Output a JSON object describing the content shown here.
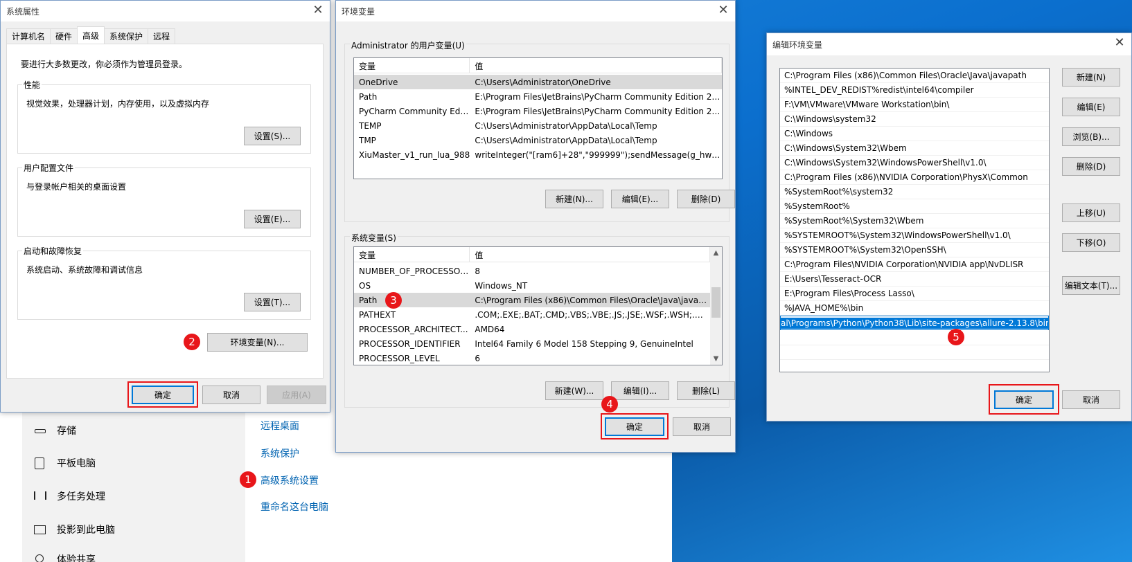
{
  "settings_window": {
    "left_items": [
      {
        "label": "存储",
        "icon": "storage-icon"
      },
      {
        "label": "平板电脑",
        "icon": "tablet-icon"
      },
      {
        "label": "多任务处理",
        "icon": "multitask-icon"
      },
      {
        "label": "投影到此电脑",
        "icon": "project-icon"
      },
      {
        "label": "体验共享",
        "icon": "share-icon"
      }
    ],
    "links": [
      "远程桌面",
      "系统保护",
      "高级系统设置",
      "重命名这台电脑"
    ]
  },
  "system_properties": {
    "title": "系统属性",
    "tabs": [
      "计算机名",
      "硬件",
      "高级",
      "系统保护",
      "远程"
    ],
    "admin_note": "要进行大多数更改，你必须作为管理员登录。",
    "performance": {
      "label": "性能",
      "desc": "视觉效果，处理器计划，内存使用，以及虚拟内存",
      "button": "设置(S)..."
    },
    "user_profile": {
      "label": "用户配置文件",
      "desc": "与登录帐户相关的桌面设置",
      "button": "设置(E)..."
    },
    "startup": {
      "label": "启动和故障恢复",
      "desc": "系统启动、系统故障和调试信息",
      "button": "设置(T)..."
    },
    "env_button": "环境变量(N)...",
    "ok": "确定",
    "cancel": "取消",
    "apply": "应用(A)"
  },
  "env_vars": {
    "title": "环境变量",
    "user_section": "Administrator 的用户变量(U)",
    "col_var": "变量",
    "col_val": "值",
    "user_vars": [
      {
        "name": "OneDrive",
        "value": "C:\\Users\\Administrator\\OneDrive"
      },
      {
        "name": "Path",
        "value": "E:\\Program Files\\JetBrains\\PyCharm Community Edition 2024...."
      },
      {
        "name": "PyCharm Community Editi...",
        "value": "E:\\Program Files\\JetBrains\\PyCharm Community Edition 2024...."
      },
      {
        "name": "TEMP",
        "value": "C:\\Users\\Administrator\\AppData\\Local\\Temp"
      },
      {
        "name": "TMP",
        "value": "C:\\Users\\Administrator\\AppData\\Local\\Temp"
      },
      {
        "name": "XiuMaster_v1_run_lua_988",
        "value": "writeInteger(\"[ram6]+28\",\"999999\");sendMessage(g_hwnd_ui,..."
      }
    ],
    "user_new": "新建(N)...",
    "user_edit": "编辑(E)...",
    "user_delete": "删除(D)",
    "system_section": "系统变量(S)",
    "system_vars": [
      {
        "name": "NUMBER_OF_PROCESSORS",
        "value": "8"
      },
      {
        "name": "OS",
        "value": "Windows_NT"
      },
      {
        "name": "Path",
        "value": "C:\\Program Files (x86)\\Common Files\\Oracle\\Java\\javapath;%..."
      },
      {
        "name": "PATHEXT",
        "value": ".COM;.EXE;.BAT;.CMD;.VBS;.VBE;.JS;.JSE;.WSF;.WSH;.MSC"
      },
      {
        "name": "PROCESSOR_ARCHITECT...",
        "value": "AMD64"
      },
      {
        "name": "PROCESSOR_IDENTIFIER",
        "value": "Intel64 Family 6 Model 158 Stepping 9, GenuineIntel"
      },
      {
        "name": "PROCESSOR_LEVEL",
        "value": "6"
      }
    ],
    "sys_new": "新建(W)...",
    "sys_edit": "编辑(I)...",
    "sys_delete": "删除(L)",
    "ok": "确定",
    "cancel": "取消"
  },
  "edit_env": {
    "title": "编辑环境变量",
    "paths": [
      "C:\\Program Files (x86)\\Common Files\\Oracle\\Java\\javapath",
      "%INTEL_DEV_REDIST%redist\\intel64\\compiler",
      "F:\\VM\\VMware\\VMware Workstation\\bin\\",
      "C:\\Windows\\system32",
      "C:\\Windows",
      "C:\\Windows\\System32\\Wbem",
      "C:\\Windows\\System32\\WindowsPowerShell\\v1.0\\",
      "C:\\Program Files (x86)\\NVIDIA Corporation\\PhysX\\Common",
      "%SystemRoot%\\system32",
      "%SystemRoot%",
      "%SystemRoot%\\System32\\Wbem",
      "%SYSTEMROOT%\\System32\\WindowsPowerShell\\v1.0\\",
      "%SYSTEMROOT%\\System32\\OpenSSH\\",
      "C:\\Program Files\\NVIDIA Corporation\\NVIDIA app\\NvDLISR",
      "E:\\Users\\Tesseract-OCR",
      "E:\\Program Files\\Process Lasso\\",
      "%JAVA_HOME%\\bin"
    ],
    "editing_value": "al\\Programs\\Python\\Python38\\Lib\\site-packages\\allure-2.13.8\\bin",
    "buttons": {
      "new": "新建(N)",
      "edit": "编辑(E)",
      "browse": "浏览(B)...",
      "delete": "删除(D)",
      "up": "上移(U)",
      "down": "下移(O)",
      "edit_text": "编辑文本(T)..."
    },
    "ok": "确定",
    "cancel": "取消"
  },
  "callouts": [
    "1",
    "2",
    "3",
    "4",
    "5"
  ],
  "colors": {
    "callout": "#e8161a",
    "link": "#0063b1",
    "selection": "#0078d7"
  }
}
